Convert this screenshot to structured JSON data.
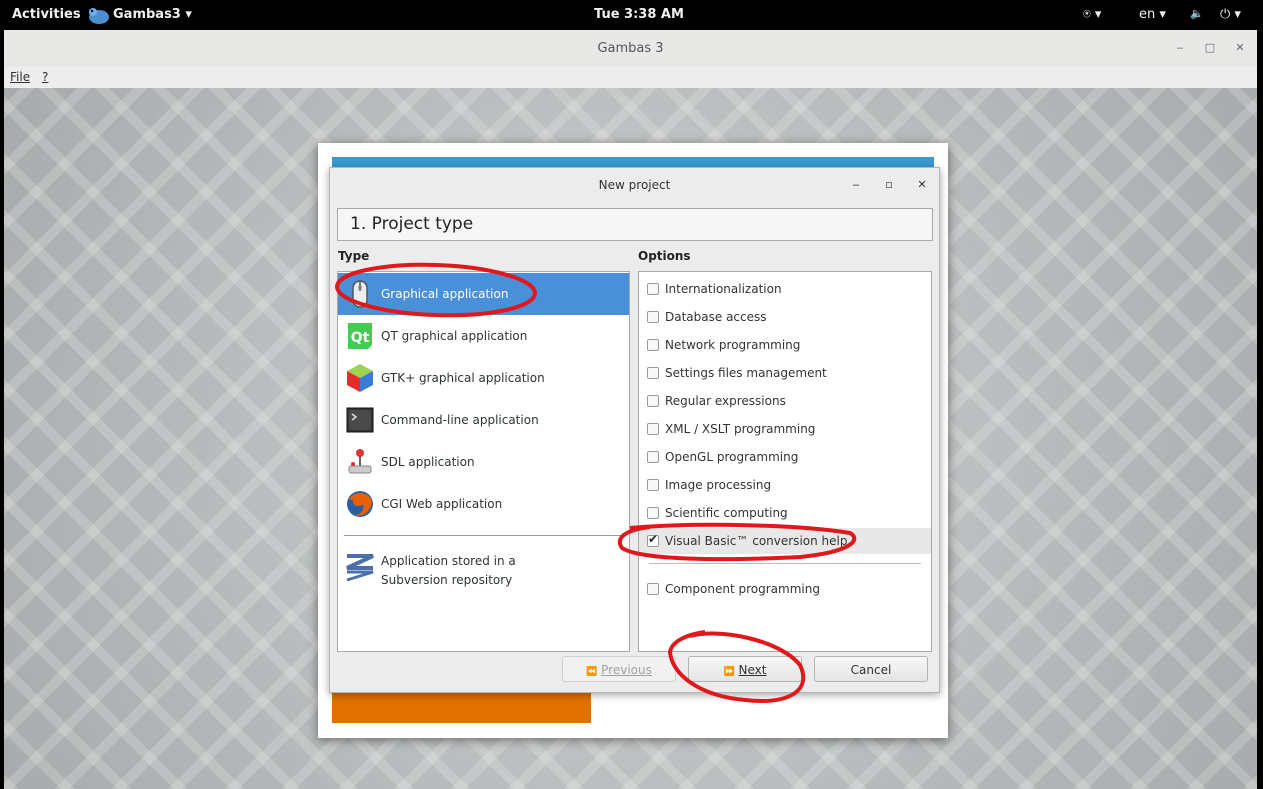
{
  "topbar": {
    "activities": "Activities",
    "app_name": "Gambas3 ▾",
    "clock": "Tue  3:38 AM",
    "accessibility": "⍟ ▾",
    "language": "en ▾",
    "volume": "🔈",
    "power": "⏻ ▾"
  },
  "window": {
    "title": "Gambas 3",
    "minimize": "‒",
    "maximize": "□",
    "close": "✕"
  },
  "menubar": {
    "file": "File",
    "help": "?"
  },
  "dialog": {
    "title": "New project",
    "minimize": "‒",
    "maximize": "▫",
    "close": "✕",
    "step_title": "1. Project type",
    "type_label": "Type",
    "options_label": "Options",
    "types": [
      {
        "label": "Graphical application",
        "icon": "mouse-icon",
        "selected": true
      },
      {
        "label": "QT graphical application",
        "icon": "qt-icon"
      },
      {
        "label": "GTK+ graphical application",
        "icon": "gtk-icon"
      },
      {
        "label": "Command-line application",
        "icon": "terminal-icon"
      },
      {
        "label": "SDL application",
        "icon": "joystick-icon"
      },
      {
        "label": "CGI Web application",
        "icon": "firefox-icon"
      }
    ],
    "repo_item": {
      "line1": "Application stored in a",
      "line2": "Subversion repository",
      "icon": "subversion-icon"
    },
    "options": [
      {
        "label": "Internationalization",
        "checked": false
      },
      {
        "label": "Database access",
        "checked": false
      },
      {
        "label": "Network programming",
        "checked": false
      },
      {
        "label": "Settings files management",
        "checked": false
      },
      {
        "label": "Regular expressions",
        "checked": false
      },
      {
        "label": "XML / XSLT programming",
        "checked": false
      },
      {
        "label": "OpenGL programming",
        "checked": false
      },
      {
        "label": "Image processing",
        "checked": false
      },
      {
        "label": "Scientific computing",
        "checked": false
      },
      {
        "label": "Visual Basic™ conversion help",
        "checked": true
      },
      {
        "label": "Component programming",
        "checked": false
      }
    ],
    "buttons": {
      "previous_icon": "⏪",
      "previous": "Previous",
      "next_icon": "⏩",
      "next": "Next",
      "cancel": "Cancel"
    }
  },
  "colors": {
    "selection": "#4a90d9",
    "annotation": "#e0181b",
    "splash_blue": "#3a9ad1",
    "splash_orange": "#e07000"
  }
}
